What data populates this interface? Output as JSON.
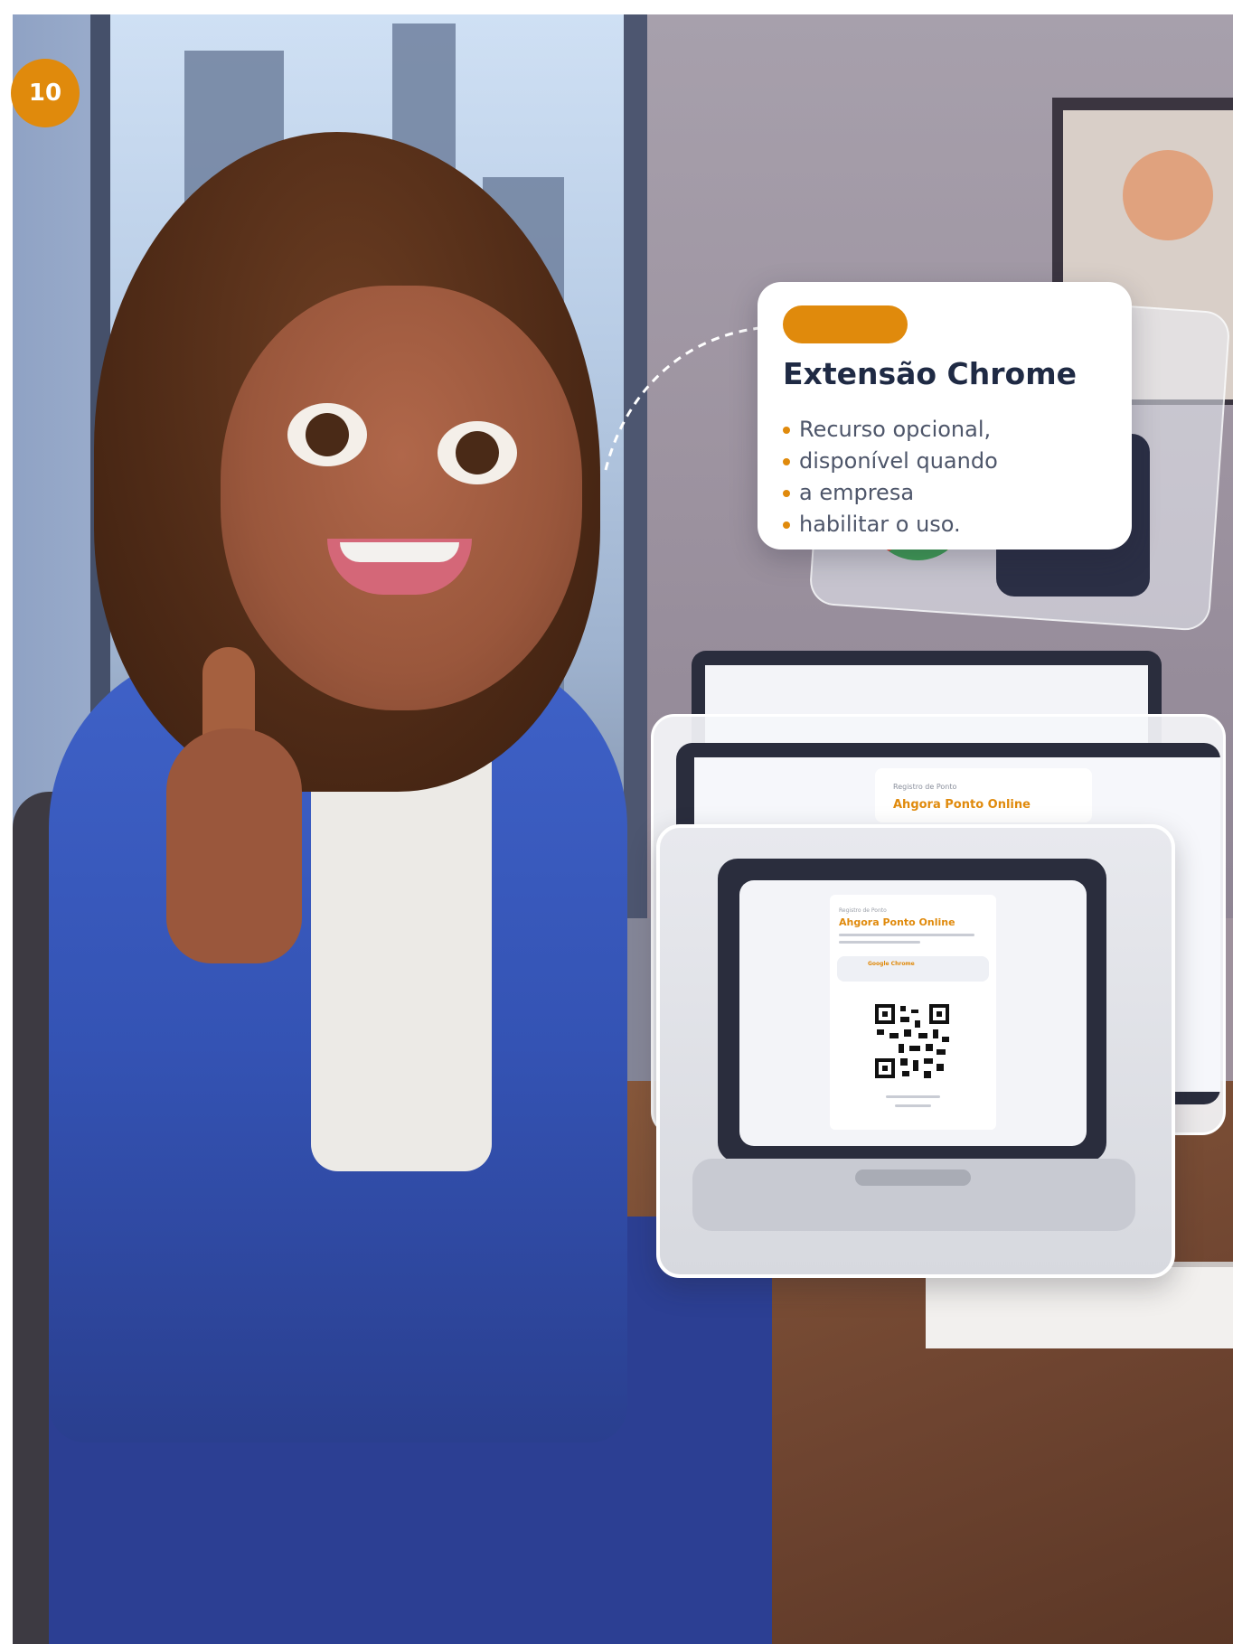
{
  "step_badge": "10",
  "callout": {
    "title": "Extensão Chrome",
    "items": [
      "Recurso opcional,",
      "disponível quando",
      "a empresa",
      "habilitar o uso."
    ]
  },
  "laptop_mid": {
    "subtitle": "Registro de Ponto",
    "title": "Ahgora Ponto Online"
  },
  "laptop_front": {
    "subtitle": "Registro de Ponto",
    "title": "Ahgora Ponto Online",
    "chip": "Google Chrome"
  },
  "colors": {
    "accent": "#e08a0c",
    "navy": "#1f2a44",
    "blazer": "#3453b4"
  },
  "icons": [
    "chrome-icon",
    "puzzle-icon",
    "qr-code-icon"
  ]
}
